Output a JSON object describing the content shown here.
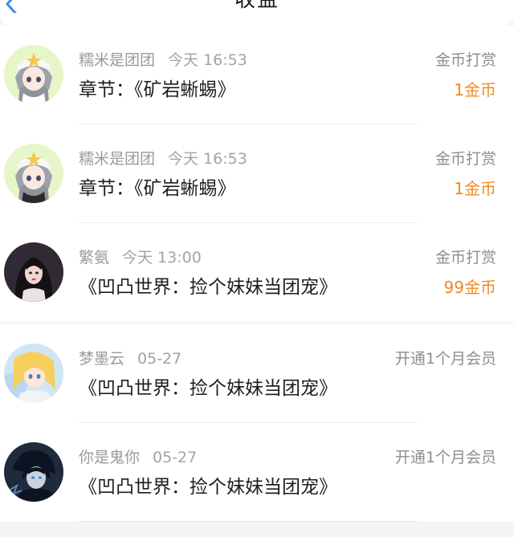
{
  "header": {
    "title": "收益",
    "back_icon": "chevron-left-icon"
  },
  "records": [
    {
      "username": "糯米是团团",
      "time": "今天 16:53",
      "content": "章节：《矿岩蜥蜴》",
      "type": "金币打赏",
      "amount": "1金币"
    },
    {
      "username": "糯米是团团",
      "time": "今天 16:53",
      "content": "章节：《矿岩蜥蜴》",
      "type": "金币打赏",
      "amount": "1金币"
    },
    {
      "username": "繁氨",
      "time": "今天 13:00",
      "content": "《凹凸世界：捡个妹妹当团宠》",
      "type": "金币打赏",
      "amount": "99金币"
    },
    {
      "username": "梦墨云",
      "time": "05-27",
      "content": "《凹凸世界：捡个妹妹当团宠》",
      "type": "开通1个月会员",
      "amount": ""
    },
    {
      "username": "你是鬼你",
      "time": "05-27",
      "content": "《凹凸世界：捡个妹妹当团宠》",
      "type": "开通1个月会员",
      "amount": ""
    }
  ],
  "colors": {
    "accent": "#f08a24",
    "back_icon": "#3a8ee6",
    "page_background": "#f4f5f7"
  }
}
